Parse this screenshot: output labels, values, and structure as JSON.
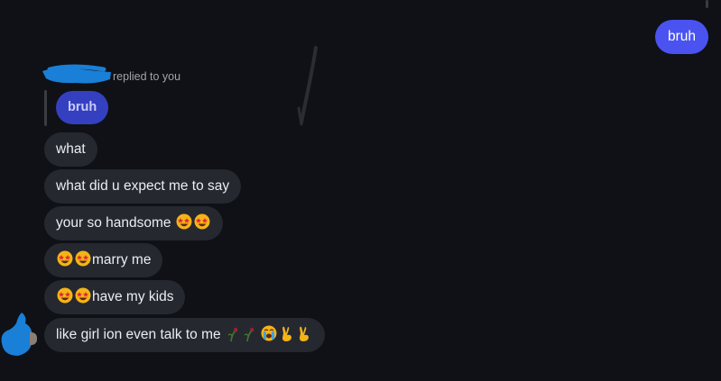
{
  "outgoing": {
    "message": "bruh"
  },
  "reply": {
    "label": "replied to you",
    "quoted_text": "bruh"
  },
  "messages": [
    {
      "text": "what"
    },
    {
      "text": "what did u expect me to say"
    },
    {
      "text": "your so handsome",
      "emoji_after": [
        "star-struck",
        "star-struck"
      ]
    },
    {
      "text": "marry me",
      "emoji_before": [
        "star-struck",
        "star-struck"
      ]
    },
    {
      "text": "have my kids",
      "emoji_before": [
        "star-struck",
        "star-struck"
      ]
    },
    {
      "text": "like girl ion even talk to me",
      "emoji_after": [
        "wilted-rose",
        "wilted-rose",
        "loudly-crying-face",
        "victory-hand",
        "victory-hand"
      ]
    }
  ],
  "colors": {
    "background": "#0f1116",
    "incoming_bubble": "#262830",
    "outgoing_bubble": "#4a53f0",
    "quoted_bubble": "#3440c0",
    "redaction_blue": "#1a7fd6"
  }
}
